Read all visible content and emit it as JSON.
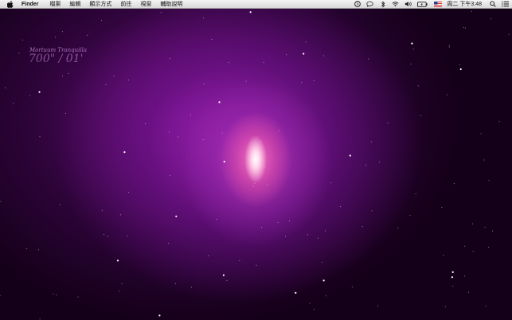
{
  "menubar": {
    "app_name": "Finder",
    "menus": [
      "檔案",
      "編輯",
      "顯示方式",
      "前往",
      "視窗",
      "輔助說明"
    ],
    "status_icons": [
      "time-machine-icon",
      "chat-icon",
      "bluetooth-icon",
      "wifi-icon",
      "volume-icon",
      "battery-icon",
      "flag-us-icon"
    ],
    "clock": "周二 下午3:48"
  },
  "wallpaper": {
    "title": "",
    "subtitle": "Mortuum Tranquilla",
    "coordinates": "700\" / 01'",
    "paragraphs": [],
    "colors": {
      "deep": "#140018",
      "nebula": "#8c1fa6",
      "core": "#ffd6ec"
    }
  }
}
